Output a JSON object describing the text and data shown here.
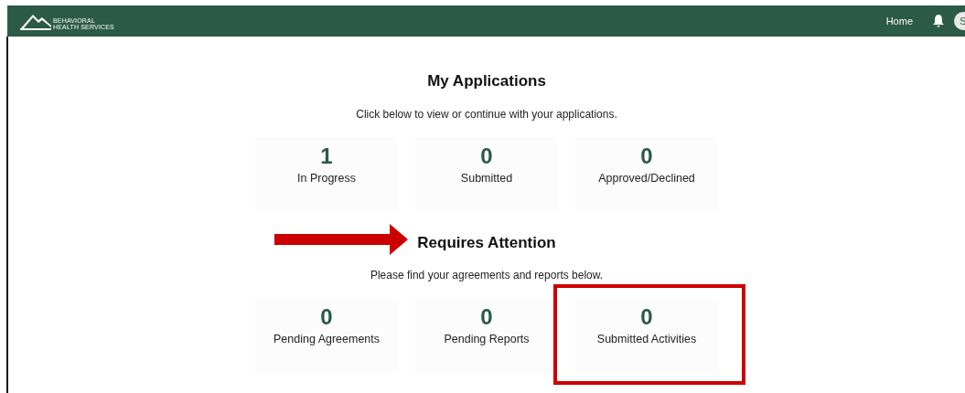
{
  "header": {
    "logo_lines": [
      "BEHAVIORAL",
      "HEALTH SERVICES"
    ],
    "nav": [
      {
        "label": "Home"
      }
    ],
    "avatar": "S"
  },
  "sections": [
    {
      "title": "My Applications",
      "subtitle": "Click below to view or continue with your applications.",
      "pointer_arrow": false,
      "cards": [
        {
          "count": "1",
          "label": "In Progress",
          "highlighted": false
        },
        {
          "count": "0",
          "label": "Submitted",
          "highlighted": false
        },
        {
          "count": "0",
          "label": "Approved/Declined",
          "highlighted": false
        }
      ]
    },
    {
      "title": "Requires Attention",
      "subtitle": "Please find your agreements and reports below.",
      "pointer_arrow": true,
      "cards": [
        {
          "count": "0",
          "label": "Pending Agreements",
          "highlighted": false
        },
        {
          "count": "0",
          "label": "Pending Reports",
          "highlighted": false
        },
        {
          "count": "0",
          "label": "Submitted Activities",
          "highlighted": true
        }
      ]
    }
  ]
}
